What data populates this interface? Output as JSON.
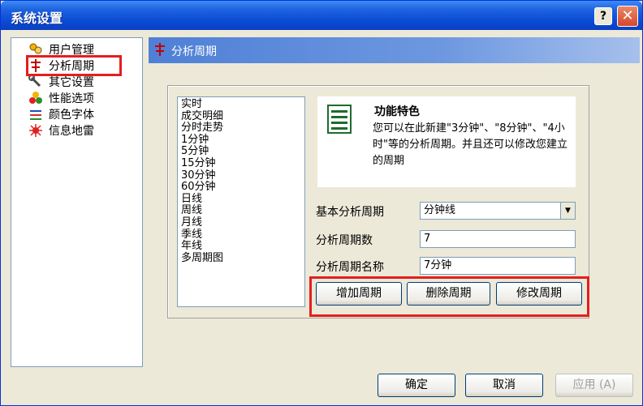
{
  "window": {
    "title": "系统设置",
    "help_label": "?",
    "close_label": "✕"
  },
  "tree": {
    "items": [
      {
        "label": "用户管理",
        "icon": "users-icon"
      },
      {
        "label": "分析周期",
        "icon": "period-icon"
      },
      {
        "label": "其它设置",
        "icon": "wrench-icon"
      },
      {
        "label": "性能选项",
        "icon": "performance-icon"
      },
      {
        "label": "颜色字体",
        "icon": "font-color-icon"
      },
      {
        "label": "信息地雷",
        "icon": "mine-icon"
      }
    ],
    "selected": "分析周期"
  },
  "header": {
    "title": "分析周期",
    "icon": "period-icon"
  },
  "period_list": [
    "实时",
    "成交明细",
    "分时走势",
    "1分钟",
    "5分钟",
    "15分钟",
    "30分钟",
    "60分钟",
    "日线",
    "周线",
    "月线",
    "季线",
    "年线",
    "多周期图"
  ],
  "feature": {
    "title": "功能特色",
    "description": "您可以在此新建\"3分钟\"、\"8分钟\"、\"4小时\"等的分析周期。并且还可以修改您建立的周期"
  },
  "form": {
    "base_period_label": "基本分析周期",
    "base_period_value": "分钟线",
    "period_count_label": "分析周期数",
    "period_count_value": "7",
    "period_name_label": "分析周期名称",
    "period_name_value": "7分钟"
  },
  "actions": {
    "add_label": "增加周期",
    "delete_label": "删除周期",
    "modify_label": "修改周期"
  },
  "footer": {
    "ok_label": "确定",
    "cancel_label": "取消",
    "apply_label": "应用 (A)"
  },
  "colors": {
    "title_bar": "#0a4bd6",
    "highlight": "#e41e1e",
    "header_strip": "#4f80d6"
  }
}
